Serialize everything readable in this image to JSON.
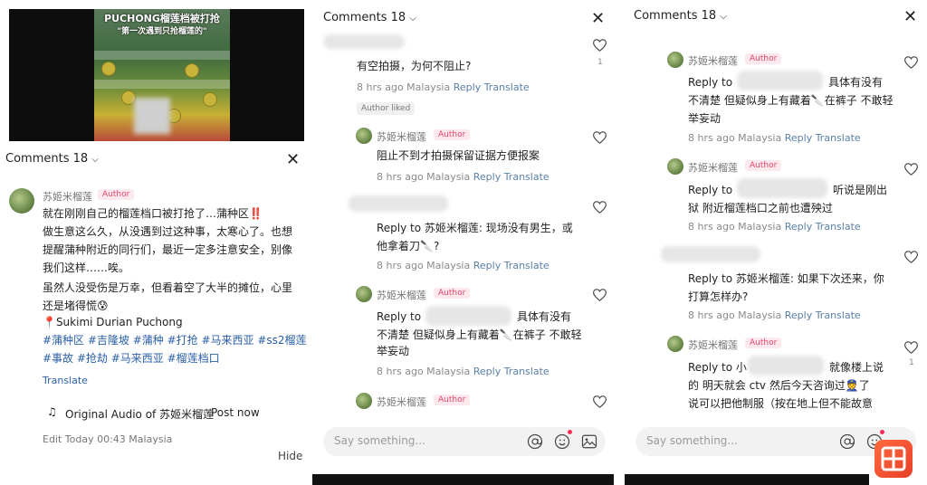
{
  "panel1": {
    "video": {
      "title1": "PUCHONG榴莲档被打抢",
      "title2": "\"第一次遇到只抢榴莲的\""
    },
    "comments_header": "Comments 18",
    "post": {
      "author": "苏姬米榴莲",
      "badge": "Author",
      "lines": [
        "就在刚刚自己的榴莲档口被打抢了…蒲种区‼️",
        "做生意这么久，从没遇到过这种事，太寒心了。也想",
        "提醒蒲种附近的同行们，最近一定多注意安全，别像",
        "我们这样……唉。",
        "虽然人没受伤是万幸，但看着空了大半的摊位，心里",
        "还是堵得慌😰",
        "📍Sukimi Durian Puchong",
        "#蒲种区 #吉隆坡 #蒲种 #打抢 #马来西亚 #ss2榴莲",
        "#事故 #抢劫 #马来西亚 #榴莲档口"
      ],
      "translate": "Translate",
      "audio": "Original Audio of 苏姬米榴莲",
      "post_now": "Post now",
      "edit": "Edit Today 00:43 Malaysia",
      "hide": "Hide"
    }
  },
  "panel2": {
    "comments_header": "Comments 18",
    "c1": {
      "text": "有空拍摄，为何不阻止?",
      "meta": "8 hrs ago Malaysia",
      "likes": "1"
    },
    "author_liked": "Author liked",
    "r1": {
      "author": "苏姬米榴莲",
      "badge": "Author",
      "text": "阻止不到才拍摄保留证据方便报案",
      "meta": "8 hrs ago Malaysia"
    },
    "r2": {
      "line1": "Reply to 苏姬米榴莲: 现场没有男生，或",
      "line2": "他拿着刀🔪?",
      "meta": "8 hrs ago Malaysia"
    },
    "r3": {
      "author": "苏姬米榴莲",
      "badge": "Author",
      "line1_a": "Reply to",
      "line1_b": "具体有没有",
      "line2": "不清楚 但疑似身上有藏着🔪在裤子 不敢轻",
      "line3": "举妄动",
      "meta": "8 hrs ago Malaysia"
    },
    "r4": {
      "author": "苏姬米榴莲",
      "badge": "Author"
    },
    "reply": "Reply",
    "translate": "Translate",
    "input_placeholder": "Say something..."
  },
  "panel3": {
    "comments_header": "Comments 18",
    "r1": {
      "author": "苏姬米榴莲",
      "badge": "Author",
      "line1_a": "Reply to",
      "line1_b": "具体有没有",
      "line2": "不清楚 但疑似身上有藏着🔪在裤子 不敢轻",
      "line3": "举妄动",
      "meta": "8 hrs ago Malaysia"
    },
    "r2": {
      "author": "苏姬米榴莲",
      "badge": "Author",
      "line1_a": "Reply to",
      "line1_b": "听说是刚出",
      "line2": "狱 附近榴莲档口之前也遭殃过",
      "meta": "8 hrs ago Malaysia"
    },
    "r3": {
      "line1": "Reply to 苏姬米榴莲: 如果下次还来，你",
      "line2": "打算怎样办?",
      "meta": "8 hrs ago Malaysia"
    },
    "r4": {
      "author": "苏姬米榴莲",
      "badge": "Author",
      "line1_a": "Reply to 小",
      "line1_b": "就像楼上说",
      "line2": "的 明天就会   ctv 然后今天咨询过👮了",
      "line3": "说可以把他制服（按在地上但不能故意",
      "likes": "1"
    },
    "reply": "Reply",
    "translate": "Translate",
    "input_placeholder": "Say something..."
  }
}
